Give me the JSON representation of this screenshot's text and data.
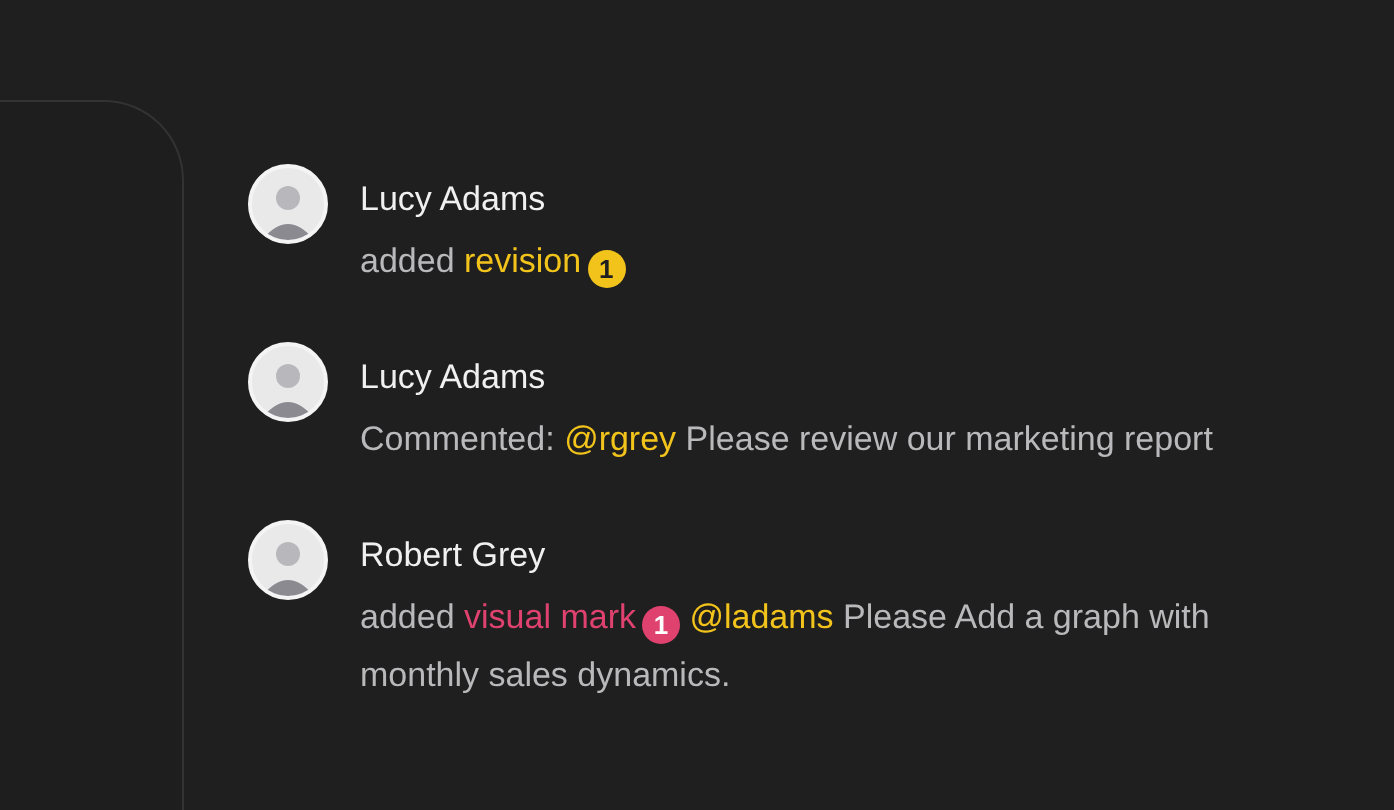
{
  "activities": [
    {
      "author": "Lucy Adams",
      "segments": [
        {
          "kind": "text",
          "text": "added"
        },
        {
          "kind": "link",
          "text": "revision",
          "color": "#f2c31b"
        },
        {
          "kind": "badge",
          "text": "1",
          "color": "#f2c31b"
        }
      ]
    },
    {
      "author": "Lucy Adams",
      "segments": [
        {
          "kind": "text",
          "text": "Commented:"
        },
        {
          "kind": "mention",
          "text": "@rgrey"
        },
        {
          "kind": "text",
          "text": "Please review our marketing report"
        }
      ]
    },
    {
      "author": "Robert Grey",
      "segments": [
        {
          "kind": "text",
          "text": "added"
        },
        {
          "kind": "link",
          "text": "visual mark",
          "color": "#e0426f"
        },
        {
          "kind": "badge",
          "text": "1",
          "color": "#e0426f"
        },
        {
          "kind": "mention",
          "text": "@ladams"
        },
        {
          "kind": "text",
          "text": "Please Add a graph with monthly sales dynamics."
        }
      ]
    }
  ]
}
